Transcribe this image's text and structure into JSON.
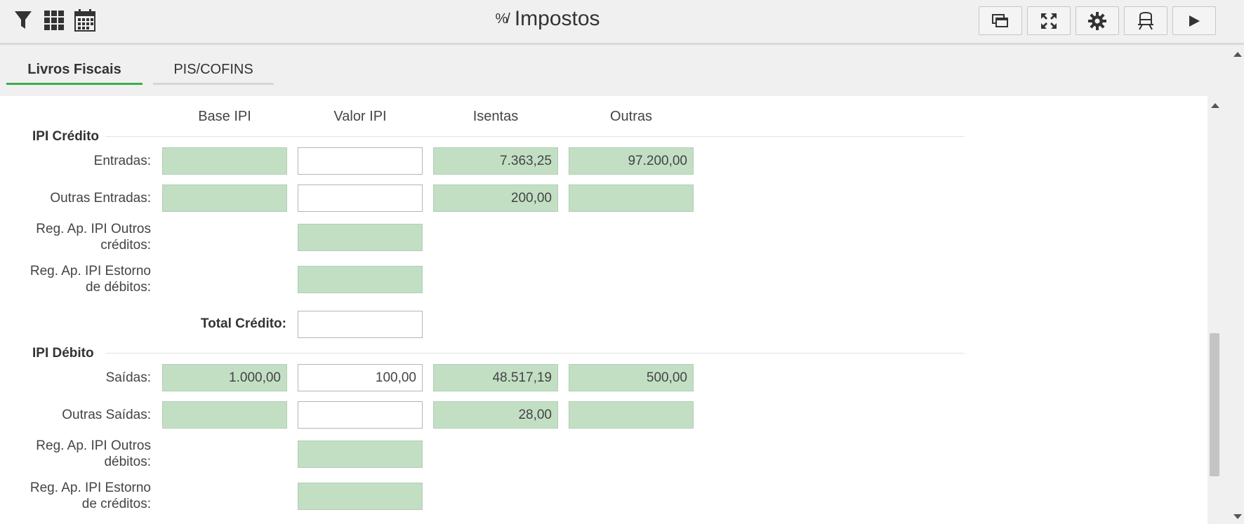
{
  "toolbar": {
    "title": "Impostos",
    "title_icon_glyph": "%/",
    "left_icons": [
      "filter-icon",
      "grid-icon",
      "calendar-icon"
    ],
    "right_buttons": [
      "window-icon",
      "fullscreen-icon",
      "gear-icon",
      "train-icon",
      "play-icon"
    ]
  },
  "tabs": [
    {
      "label": "Livros Fiscais",
      "active": true
    },
    {
      "label": "PIS/COFINS",
      "active": false
    }
  ],
  "columns": [
    "Base IPI",
    "Valor IPI",
    "Isentas",
    "Outras"
  ],
  "credito": {
    "title": "IPI Crédito",
    "entradas": {
      "label": "Entradas:",
      "base": "",
      "valor": "",
      "isentas": "7.363,25",
      "outras": "97.200,00"
    },
    "outras_entradas": {
      "label": "Outras Entradas:",
      "base": "",
      "valor": "",
      "isentas": "200,00",
      "outras": ""
    },
    "outros_creditos": {
      "label_line1": "Reg. Ap. IPI Outros",
      "label_line2": "créditos:",
      "valor": ""
    },
    "estorno_debitos": {
      "label_line1": "Reg. Ap. IPI Estorno",
      "label_line2": "de débitos:",
      "valor": ""
    },
    "total": {
      "label": "Total Crédito:",
      "valor": ""
    }
  },
  "debito": {
    "title": "IPI Débito",
    "saidas": {
      "label": "Saídas:",
      "base": "1.000,00",
      "valor": "100,00",
      "isentas": "48.517,19",
      "outras": "500,00"
    },
    "outras_saidas": {
      "label": "Outras Saídas:",
      "base": "",
      "valor": "",
      "isentas": "28,00",
      "outras": ""
    },
    "outros_debitos": {
      "label_line1": "Reg. Ap. IPI Outros",
      "label_line2": "débitos:",
      "valor": ""
    },
    "estorno_creditos": {
      "label_line1": "Reg. Ap. IPI Estorno",
      "label_line2": "de créditos:",
      "valor": ""
    }
  },
  "colors": {
    "readonly_field": "#c2dfc4",
    "active_tab": "#3cae4a"
  }
}
